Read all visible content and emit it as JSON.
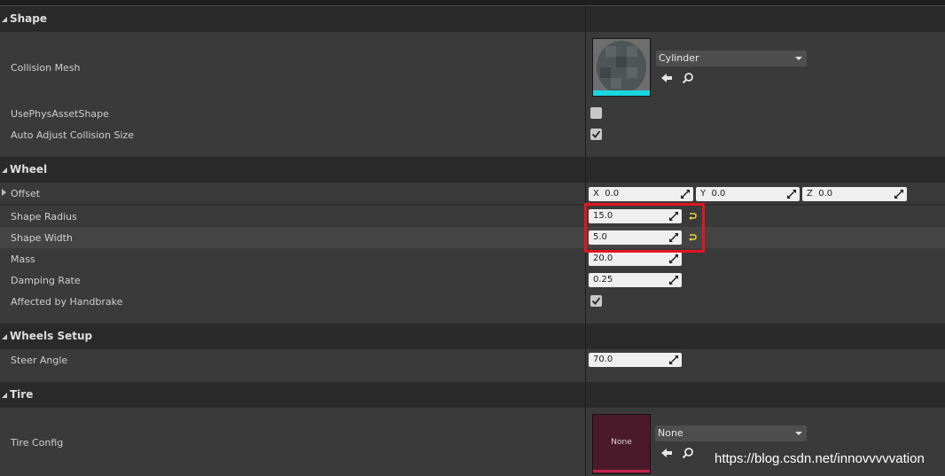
{
  "sections": {
    "shape": "Shape",
    "wheel": "Wheel",
    "wheels_setup": "Wheels Setup",
    "tire": "Tire"
  },
  "shape": {
    "collision_mesh_label": "Collision Mesh",
    "collision_mesh_value": "Cylinder",
    "use_phys_asset_shape_label": "UsePhysAssetShape",
    "use_phys_asset_shape_checked": false,
    "auto_adjust_label": "Auto Adjust Collision Size",
    "auto_adjust_checked": true
  },
  "wheel": {
    "offset_label": "Offset",
    "offset_x_label": "X",
    "offset_x": "0.0",
    "offset_y_label": "Y",
    "offset_y": "0.0",
    "offset_z_label": "Z",
    "offset_z": "0.0",
    "shape_radius_label": "Shape Radius",
    "shape_radius": "15.0",
    "shape_width_label": "Shape Width",
    "shape_width": "5.0",
    "mass_label": "Mass",
    "mass": "20.0",
    "damping_rate_label": "Damping Rate",
    "damping_rate": "0.25",
    "handbrake_label": "Affected by Handbrake",
    "handbrake_checked": true
  },
  "wheels_setup": {
    "steer_angle_label": "Steer Angle",
    "steer_angle": "70.0"
  },
  "tire": {
    "tire_config_label": "Tire Config",
    "tire_config_value": "None",
    "thumbnail_text": "None"
  },
  "watermark": "https://blog.csdn.net/innovvvvvation",
  "colors": {
    "accent_cyan": "#19d6e0",
    "tire_thumb": "#4a1a2a",
    "tire_underline": "#c2204a",
    "highlight_red": "#e3141f"
  }
}
